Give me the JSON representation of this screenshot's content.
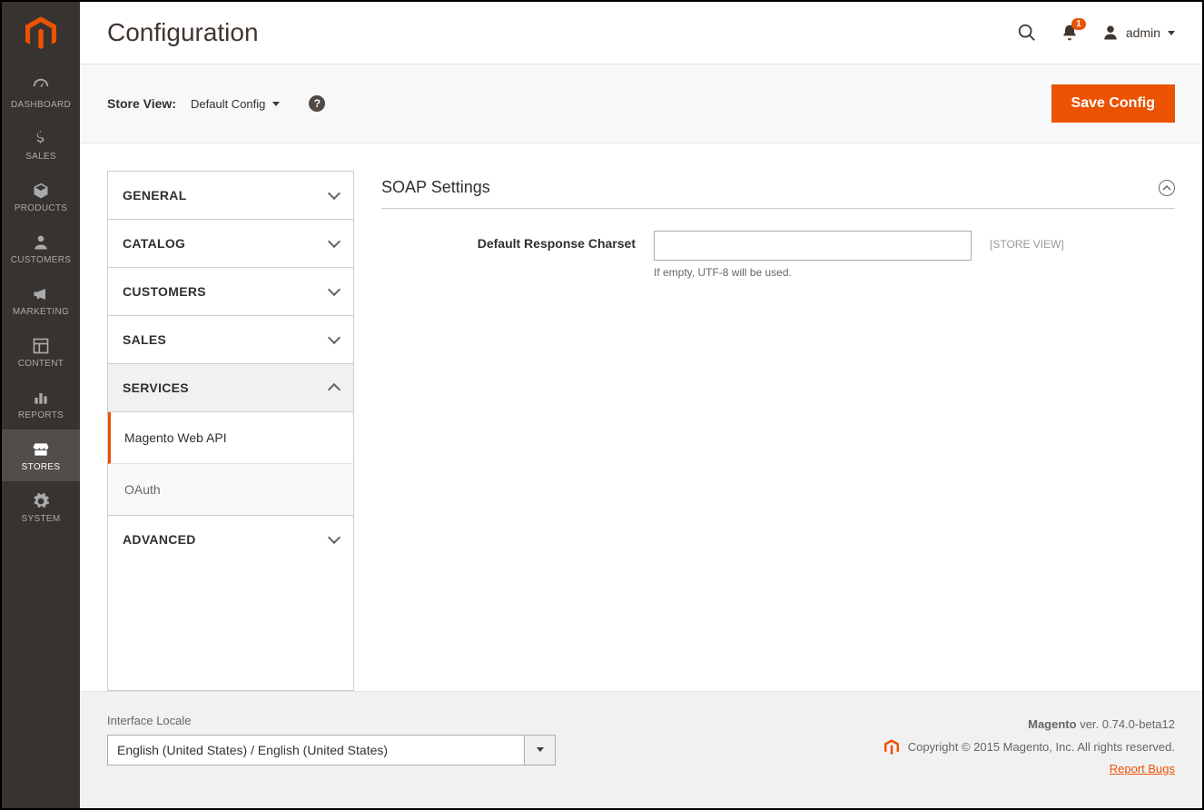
{
  "page": {
    "title": "Configuration"
  },
  "header": {
    "notification_count": "1",
    "admin_name": "admin"
  },
  "toolbar": {
    "scope_label": "Store View:",
    "scope_value": "Default Config",
    "save_label": "Save Config"
  },
  "sidebar": {
    "items": [
      {
        "label": "DASHBOARD"
      },
      {
        "label": "SALES"
      },
      {
        "label": "PRODUCTS"
      },
      {
        "label": "CUSTOMERS"
      },
      {
        "label": "MARKETING"
      },
      {
        "label": "CONTENT"
      },
      {
        "label": "REPORTS"
      },
      {
        "label": "STORES"
      },
      {
        "label": "SYSTEM"
      }
    ]
  },
  "config_nav": {
    "tabs": [
      {
        "label": "GENERAL"
      },
      {
        "label": "CATALOG"
      },
      {
        "label": "CUSTOMERS"
      },
      {
        "label": "SALES"
      },
      {
        "label": "SERVICES"
      },
      {
        "label": "ADVANCED"
      }
    ],
    "services_items": [
      {
        "label": "Magento Web API"
      },
      {
        "label": "OAuth"
      }
    ]
  },
  "section": {
    "title": "SOAP Settings",
    "field_label": "Default Response Charset",
    "field_value": "",
    "field_note": "If empty, UTF-8 will be used.",
    "field_scope": "[STORE VIEW]"
  },
  "footer": {
    "locale_label": "Interface Locale",
    "locale_value": "English (United States) / English (United States)",
    "version_prefix": "Magento",
    "version_text": " ver. 0.74.0-beta12",
    "copyright": "Copyright © 2015 Magento, Inc. All rights reserved.",
    "report_bugs": "Report Bugs"
  }
}
